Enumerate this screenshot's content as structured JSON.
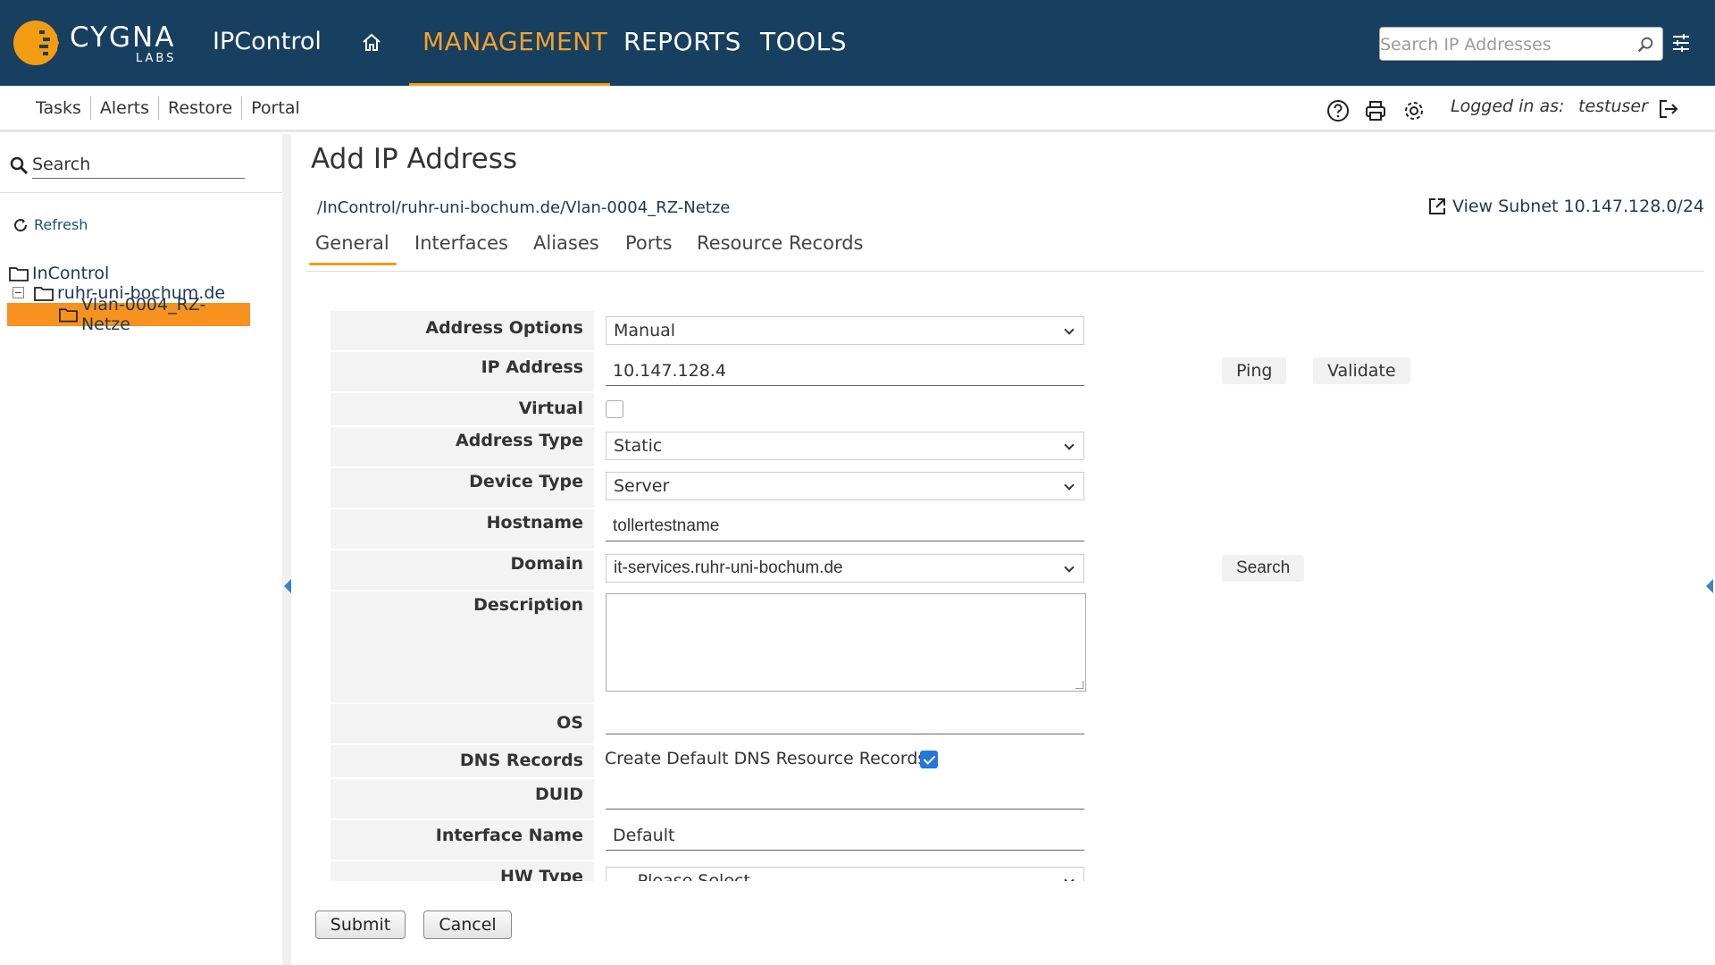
{
  "header": {
    "logo_text": "CYGNA",
    "logo_subtext": "LABS",
    "app_name": "IPControl",
    "nav": [
      "MANAGEMENT",
      "REPORTS",
      "TOOLS"
    ],
    "search_placeholder": "Search IP Addresses",
    "accent_color": "#f5a02a",
    "bar_color": "#173f5f"
  },
  "subnav": {
    "items": [
      "Tasks",
      "Alerts",
      "Restore",
      "Portal"
    ],
    "logged_in_label": "Logged in as:",
    "username": "testuser"
  },
  "sidebar": {
    "search_placeholder": "Search",
    "refresh_label": "Refresh",
    "tree": [
      "InControl",
      "ruhr-uni-bochum.de",
      "Vlan-0004_RZ-Netze"
    ]
  },
  "main": {
    "title": "Add IP Address",
    "breadcrumb": "/InControl/ruhr-uni-bochum.de/Vlan-0004_RZ-Netze",
    "view_subnet": "View Subnet 10.147.128.0/24",
    "tabs": [
      "General",
      "Interfaces",
      "Aliases",
      "Ports",
      "Resource Records"
    ],
    "active_tab": "General"
  },
  "form": {
    "address_options": {
      "label": "Address Options",
      "value": "Manual"
    },
    "ip_address": {
      "label": "IP Address",
      "value": "10.147.128.4",
      "ping": "Ping",
      "validate": "Validate"
    },
    "virtual": {
      "label": "Virtual",
      "checked": false
    },
    "address_type": {
      "label": "Address Type",
      "value": "Static"
    },
    "device_type": {
      "label": "Device Type",
      "value": "Server"
    },
    "hostname": {
      "label": "Hostname",
      "value": "tollertestname"
    },
    "domain": {
      "label": "Domain",
      "value": "it-services.ruhr-uni-bochum.de",
      "search": "Search"
    },
    "description": {
      "label": "Description",
      "value": ""
    },
    "os": {
      "label": "OS",
      "value": ""
    },
    "dns_records": {
      "label": "DNS Records",
      "text": "Create Default DNS Resource Records:",
      "checked": true
    },
    "duid": {
      "label": "DUID",
      "value": ""
    },
    "interface_name": {
      "label": "Interface Name",
      "value": "Default"
    },
    "hw_type": {
      "label": "HW Type",
      "value": "--- Please Select ---"
    }
  },
  "actions": {
    "submit": "Submit",
    "cancel": "Cancel"
  }
}
